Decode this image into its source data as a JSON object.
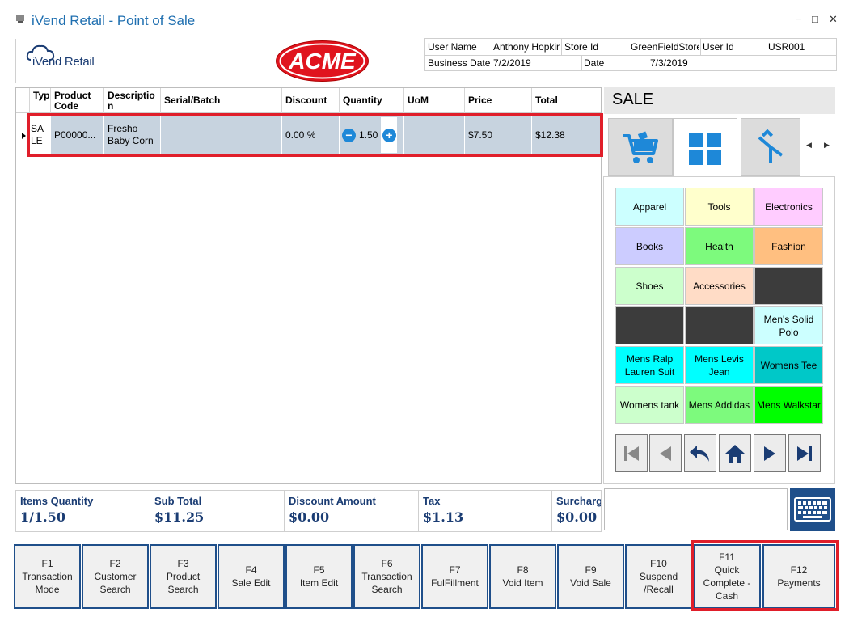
{
  "window": {
    "title": "iVend Retail - Point of Sale",
    "minimize": "−",
    "maximize": "□",
    "close": "✕"
  },
  "header": {
    "logo_text": "iVend Retail",
    "brand_badge": "ACME",
    "info": {
      "user_name_label": "User Name",
      "user_name_value": "Anthony Hopkins",
      "store_id_label": "Store Id",
      "store_id_value": "GreenFieldStore",
      "user_id_label": "User Id",
      "user_id_value": "USR001",
      "business_date_label": "Business Date",
      "business_date_value": "7/2/2019",
      "date_label": "Date",
      "date_value": "7/3/2019"
    }
  },
  "grid": {
    "columns": [
      "Type",
      "Product Code",
      "Description",
      "Serial/Batch",
      "Discount",
      "Quantity",
      "UoM",
      "Price",
      "Total"
    ],
    "rows": [
      {
        "type": "SALE",
        "product_code": "P00000...",
        "description": "Fresho Baby Corn",
        "serial_batch": "",
        "discount": "0.00 %",
        "quantity": "1.50",
        "uom": "",
        "price": "$7.50",
        "total": "$12.38"
      }
    ]
  },
  "sale_panel": {
    "title": "SALE",
    "tabs": [
      "cart-icon",
      "grid-icon",
      "merge-icon"
    ],
    "categories": [
      {
        "label": "Apparel",
        "color": "#ccffff"
      },
      {
        "label": "Tools",
        "color": "#ffffcc"
      },
      {
        "label": "Electronics",
        "color": "#ffccff"
      },
      {
        "label": "Books",
        "color": "#ccccff"
      },
      {
        "label": "Health",
        "color": "#7dfa7d"
      },
      {
        "label": "Fashion",
        "color": "#ffbf80"
      },
      {
        "label": "Shoes",
        "color": "#ccffcc"
      },
      {
        "label": "Accessories",
        "color": "#ffdcc6"
      },
      {
        "label": "",
        "color": "#3c3c3c"
      },
      {
        "label": "",
        "color": "#3c3c3c"
      },
      {
        "label": "",
        "color": "#3c3c3c"
      },
      {
        "label": "Men's Solid Polo",
        "color": "#ccffff"
      },
      {
        "label": "Mens Ralp Lauren Suit",
        "color": "#00ffff"
      },
      {
        "label": "Mens Levis Jean",
        "color": "#00ffff"
      },
      {
        "label": "Womens Tee",
        "color": "#00c8c8"
      },
      {
        "label": "Womens tank",
        "color": "#ccffcc"
      },
      {
        "label": "Mens Addidas",
        "color": "#7dfa7d"
      },
      {
        "label": "Mens Walkstar",
        "color": "#00ff00"
      }
    ]
  },
  "totals": {
    "items_quantity_label": "Items Quantity",
    "items_quantity_value": "1/1.50",
    "sub_total_label": "Sub Total",
    "sub_total_value": "$11.25",
    "discount_amount_label": "Discount Amount",
    "discount_amount_value": "$0.00",
    "tax_label": "Tax",
    "tax_value": "$1.13",
    "surcharge_label": "Surcharge",
    "surcharge_value": "$0.00"
  },
  "function_keys": [
    {
      "key": "F1",
      "label": "Transaction Mode"
    },
    {
      "key": "F2",
      "label": "Customer Search"
    },
    {
      "key": "F3",
      "label": "Product Search"
    },
    {
      "key": "F4",
      "label": "Sale Edit"
    },
    {
      "key": "F5",
      "label": "Item Edit"
    },
    {
      "key": "F6",
      "label": "Transaction Search"
    },
    {
      "key": "F7",
      "label": "FulFillment"
    },
    {
      "key": "F8",
      "label": "Void Item"
    },
    {
      "key": "F9",
      "label": "Void Sale"
    },
    {
      "key": "F10",
      "label": "Suspend /Recall"
    },
    {
      "key": "F11",
      "label": "Quick Complete - Cash"
    },
    {
      "key": "F12",
      "label": "Payments"
    }
  ]
}
